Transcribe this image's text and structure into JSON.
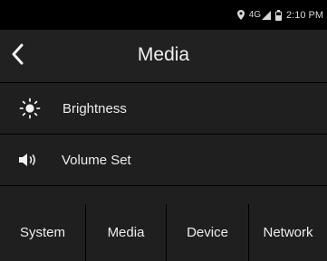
{
  "status_bar": {
    "location_icon": "location-pin-icon",
    "network": "4G",
    "signal_icon": "signal-bars-icon",
    "battery_icon": "battery-icon",
    "time": "2:10 PM"
  },
  "header": {
    "back_icon": "chevron-left-icon",
    "title": "Media"
  },
  "menu": {
    "items": [
      {
        "icon": "brightness-sun-icon",
        "label": "Brightness"
      },
      {
        "icon": "speaker-volume-icon",
        "label": "Volume Set"
      }
    ]
  },
  "tabs": [
    {
      "label": "System"
    },
    {
      "label": "Media"
    },
    {
      "label": "Device"
    },
    {
      "label": "Network"
    }
  ]
}
